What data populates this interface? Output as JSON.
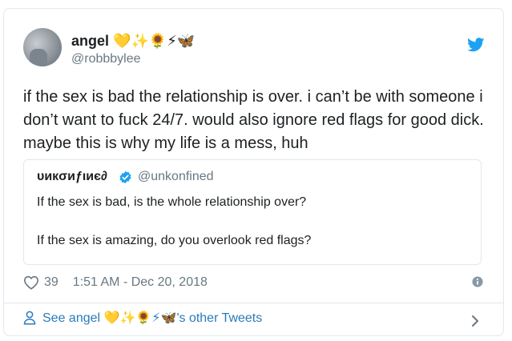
{
  "tweet": {
    "display_name": "angel",
    "name_emojis": "💛✨🌻⚡🦋",
    "handle": "@robbbylee",
    "text": "if the sex is bad the relationship is over. i can’t be with someone i don’t want to fuck 24/7. would also ignore red flags for good dick. maybe this is why my life is a mess, huh",
    "likes": "39",
    "timestamp": "1:51 AM - Dec 20, 2018"
  },
  "quoted": {
    "display_name": "υикσиƒιиє∂",
    "handle": "@unkonfined",
    "line1": "If the sex is bad, is the whole relationship over?",
    "line2": "If the sex is amazing, do you overlook red flags?"
  },
  "footer": {
    "prefix": "See angel ",
    "emojis": "💛✨🌻⚡🦋",
    "suffix": "'s other Tweets"
  },
  "colors": {
    "twitter_blue": "#1da1f2",
    "link_blue": "#2b7bb9",
    "muted": "#697882",
    "text": "#1c2022",
    "border": "#e1e8ed"
  }
}
